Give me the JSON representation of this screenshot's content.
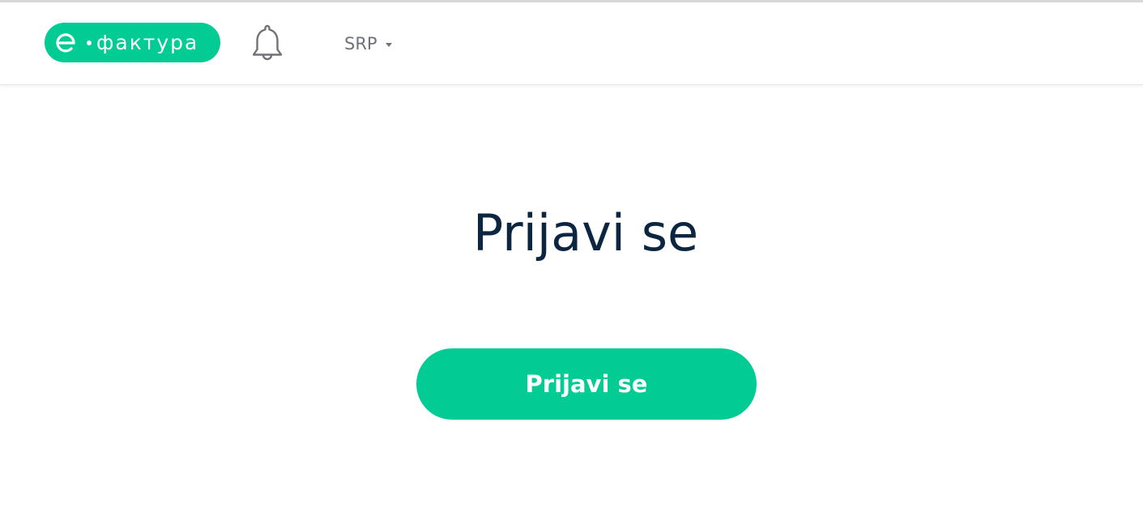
{
  "header": {
    "logo": {
      "text": "фактура",
      "icon": "e-letter-icon",
      "background_color": "#02cc94"
    },
    "notification_icon": "bell-icon",
    "language": {
      "selected": "SRP",
      "icon": "caret-down-icon"
    }
  },
  "main": {
    "title": "Prijavi se",
    "login_button_label": "Prijavi se"
  },
  "colors": {
    "accent": "#02cc94",
    "title_text": "#0c2641",
    "muted_text": "#6f7378"
  }
}
